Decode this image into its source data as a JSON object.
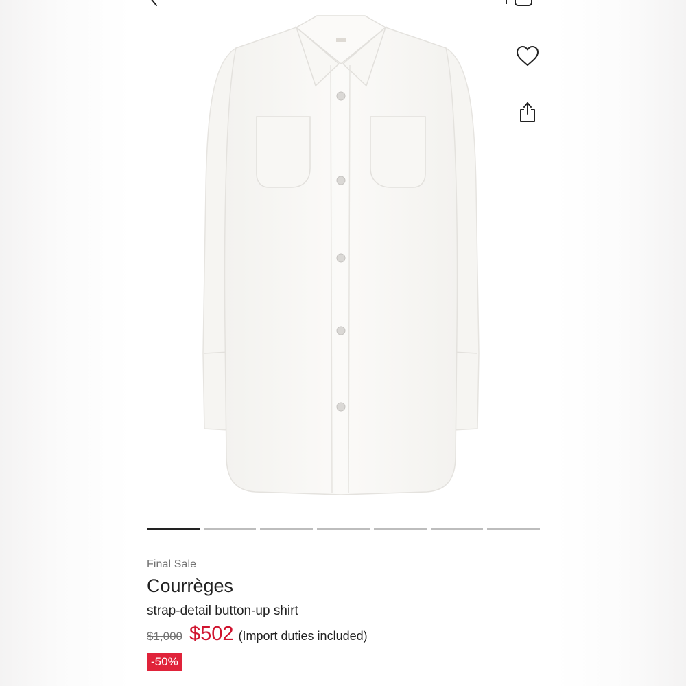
{
  "icons": {
    "back": "chevron-left-icon",
    "bag": "shopping-bag-icon",
    "wishlist": "heart-icon",
    "share": "share-icon"
  },
  "carousel": {
    "image_count": 7,
    "active_index": 0
  },
  "product": {
    "sale_label": "Final Sale",
    "brand": "Courrèges",
    "name": "strap-detail button-up shirt",
    "original_price": "$1,000",
    "sale_price": "$502",
    "price_note": "(Import duties included)",
    "discount": "-50%"
  },
  "colors": {
    "sale_red": "#d0142f",
    "badge_red": "#e0233a",
    "text_primary": "#222222",
    "text_muted": "#727272"
  }
}
